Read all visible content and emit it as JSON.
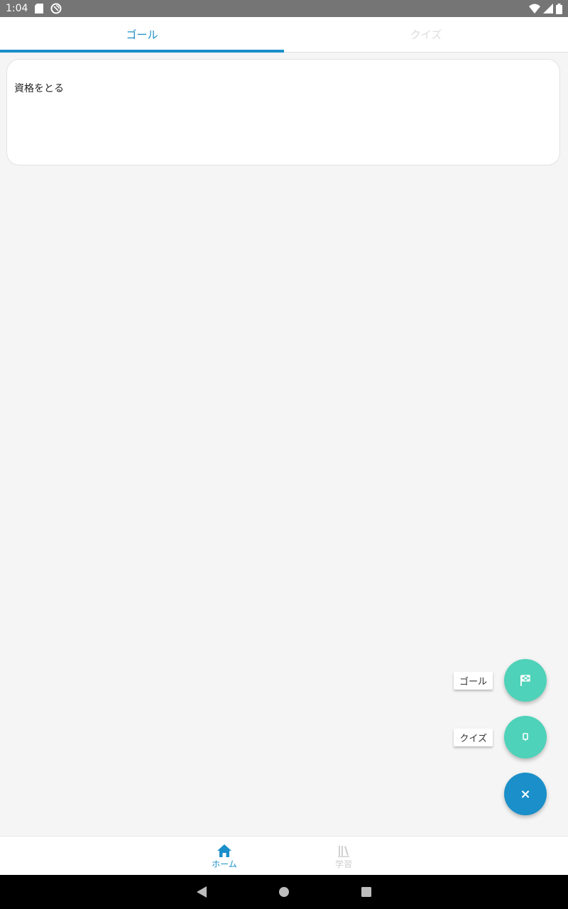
{
  "status_bar": {
    "time": "1:04"
  },
  "tabs": [
    {
      "label": "ゴール",
      "active": true
    },
    {
      "label": "クイズ",
      "active": false
    }
  ],
  "goal_card": {
    "text": "資格をとる"
  },
  "speed_dial": {
    "goal_label": "ゴール",
    "quiz_label": "クイズ",
    "close_symbol": "×"
  },
  "bottom_nav": {
    "home_label": "ホーム",
    "study_label": "学習"
  },
  "colors": {
    "accent": "#1a8fc9",
    "fab_mint": "#4ed2b9",
    "inactive": "#cfcfcf"
  }
}
